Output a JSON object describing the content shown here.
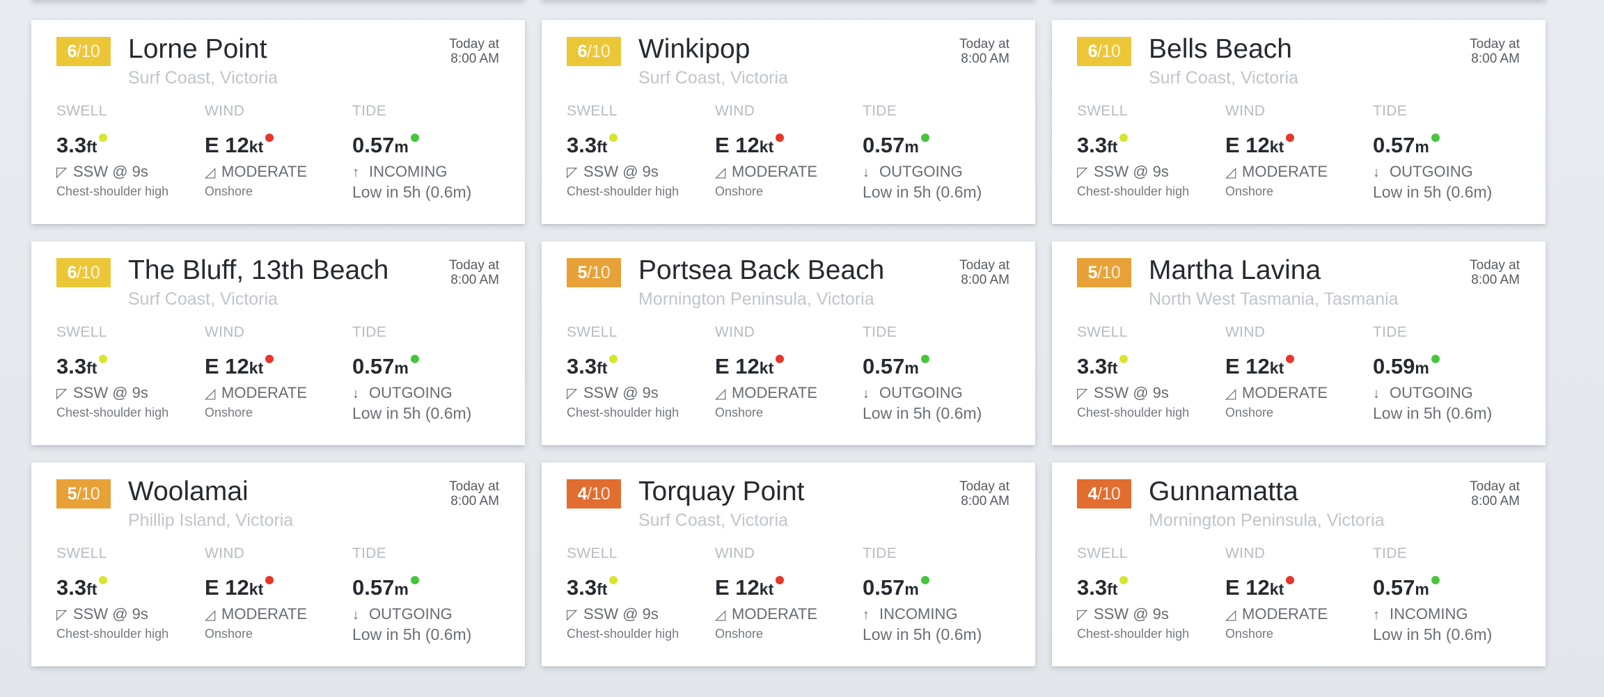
{
  "labels": {
    "swell": "SWELL",
    "wind": "WIND",
    "tide": "TIDE",
    "rating_suffix": "/10"
  },
  "colors": {
    "rating_6": "#ebc738",
    "rating_5": "#e8a137",
    "rating_4": "#e16d2f",
    "swell_dot": "#d6e62f",
    "wind_dot": "#e7362b",
    "tide_dot": "#46c63d",
    "background": "#e6eaee"
  },
  "cards": [
    {
      "rating": "6",
      "rating_color": "#ebc738",
      "name": "Lorne Point",
      "region": "Surf Coast, Victoria",
      "time_line1": "Today at",
      "time_line2": "8:00 AM",
      "swell_height": "3.3",
      "swell_unit": "ft",
      "swell_dir": "SSW @ 9s",
      "swell_desc": "Chest-shoulder high",
      "wind_value": "E 12",
      "wind_unit": "kt",
      "wind_strength": "MODERATE",
      "wind_type": "Onshore",
      "tide_height": "0.57",
      "tide_unit": "m",
      "tide_state": "INCOMING",
      "tide_direction": "up",
      "tide_next": "Low in 5h (0.6m)"
    },
    {
      "rating": "6",
      "rating_color": "#ebc738",
      "name": "Winkipop",
      "region": "Surf Coast, Victoria",
      "time_line1": "Today at",
      "time_line2": "8:00 AM",
      "swell_height": "3.3",
      "swell_unit": "ft",
      "swell_dir": "SSW @ 9s",
      "swell_desc": "Chest-shoulder high",
      "wind_value": "E 12",
      "wind_unit": "kt",
      "wind_strength": "MODERATE",
      "wind_type": "Onshore",
      "tide_height": "0.57",
      "tide_unit": "m",
      "tide_state": "OUTGOING",
      "tide_direction": "down",
      "tide_next": "Low in 5h (0.6m)"
    },
    {
      "rating": "6",
      "rating_color": "#ebc738",
      "name": "Bells Beach",
      "region": "Surf Coast, Victoria",
      "time_line1": "Today at",
      "time_line2": "8:00 AM",
      "swell_height": "3.3",
      "swell_unit": "ft",
      "swell_dir": "SSW @ 9s",
      "swell_desc": "Chest-shoulder high",
      "wind_value": "E 12",
      "wind_unit": "kt",
      "wind_strength": "MODERATE",
      "wind_type": "Onshore",
      "tide_height": "0.57",
      "tide_unit": "m",
      "tide_state": "OUTGOING",
      "tide_direction": "down",
      "tide_next": "Low in 5h (0.6m)"
    },
    {
      "rating": "6",
      "rating_color": "#ebc738",
      "name": "The Bluff, 13th Beach",
      "region": "Surf Coast, Victoria",
      "time_line1": "Today at",
      "time_line2": "8:00 AM",
      "swell_height": "3.3",
      "swell_unit": "ft",
      "swell_dir": "SSW @ 9s",
      "swell_desc": "Chest-shoulder high",
      "wind_value": "E 12",
      "wind_unit": "kt",
      "wind_strength": "MODERATE",
      "wind_type": "Onshore",
      "tide_height": "0.57",
      "tide_unit": "m",
      "tide_state": "OUTGOING",
      "tide_direction": "down",
      "tide_next": "Low in 5h (0.6m)"
    },
    {
      "rating": "5",
      "rating_color": "#e8a137",
      "name": "Portsea Back Beach",
      "region": "Mornington Peninsula, Victoria",
      "time_line1": "Today at",
      "time_line2": "8:00 AM",
      "swell_height": "3.3",
      "swell_unit": "ft",
      "swell_dir": "SSW @ 9s",
      "swell_desc": "Chest-shoulder high",
      "wind_value": "E 12",
      "wind_unit": "kt",
      "wind_strength": "MODERATE",
      "wind_type": "Onshore",
      "tide_height": "0.57",
      "tide_unit": "m",
      "tide_state": "OUTGOING",
      "tide_direction": "down",
      "tide_next": "Low in 5h (0.6m)"
    },
    {
      "rating": "5",
      "rating_color": "#e8a137",
      "name": "Martha Lavina",
      "region": "North West Tasmania, Tasmania",
      "time_line1": "Today at",
      "time_line2": "8:00 AM",
      "swell_height": "3.3",
      "swell_unit": "ft",
      "swell_dir": "SSW @ 9s",
      "swell_desc": "Chest-shoulder high",
      "wind_value": "E 12",
      "wind_unit": "kt",
      "wind_strength": "MODERATE",
      "wind_type": "Onshore",
      "tide_height": "0.59",
      "tide_unit": "m",
      "tide_state": "OUTGOING",
      "tide_direction": "down",
      "tide_next": "Low in 5h (0.6m)"
    },
    {
      "rating": "5",
      "rating_color": "#e8a137",
      "name": "Woolamai",
      "region": "Phillip Island, Victoria",
      "time_line1": "Today at",
      "time_line2": "8:00 AM",
      "swell_height": "3.3",
      "swell_unit": "ft",
      "swell_dir": "SSW @ 9s",
      "swell_desc": "Chest-shoulder high",
      "wind_value": "E 12",
      "wind_unit": "kt",
      "wind_strength": "MODERATE",
      "wind_type": "Onshore",
      "tide_height": "0.57",
      "tide_unit": "m",
      "tide_state": "OUTGOING",
      "tide_direction": "down",
      "tide_next": "Low in 5h (0.6m)"
    },
    {
      "rating": "4",
      "rating_color": "#e16d2f",
      "name": "Torquay Point",
      "region": "Surf Coast, Victoria",
      "time_line1": "Today at",
      "time_line2": "8:00 AM",
      "swell_height": "3.3",
      "swell_unit": "ft",
      "swell_dir": "SSW @ 9s",
      "swell_desc": "Chest-shoulder high",
      "wind_value": "E 12",
      "wind_unit": "kt",
      "wind_strength": "MODERATE",
      "wind_type": "Onshore",
      "tide_height": "0.57",
      "tide_unit": "m",
      "tide_state": "INCOMING",
      "tide_direction": "up",
      "tide_next": "Low in 5h (0.6m)"
    },
    {
      "rating": "4",
      "rating_color": "#e16d2f",
      "name": "Gunnamatta",
      "region": "Mornington Peninsula, Victoria",
      "time_line1": "Today at",
      "time_line2": "8:00 AM",
      "swell_height": "3.3",
      "swell_unit": "ft",
      "swell_dir": "SSW @ 9s",
      "swell_desc": "Chest-shoulder high",
      "wind_value": "E 12",
      "wind_unit": "kt",
      "wind_strength": "MODERATE",
      "wind_type": "Onshore",
      "tide_height": "0.57",
      "tide_unit": "m",
      "tide_state": "INCOMING",
      "tide_direction": "up",
      "tide_next": "Low in 5h (0.6m)"
    }
  ]
}
